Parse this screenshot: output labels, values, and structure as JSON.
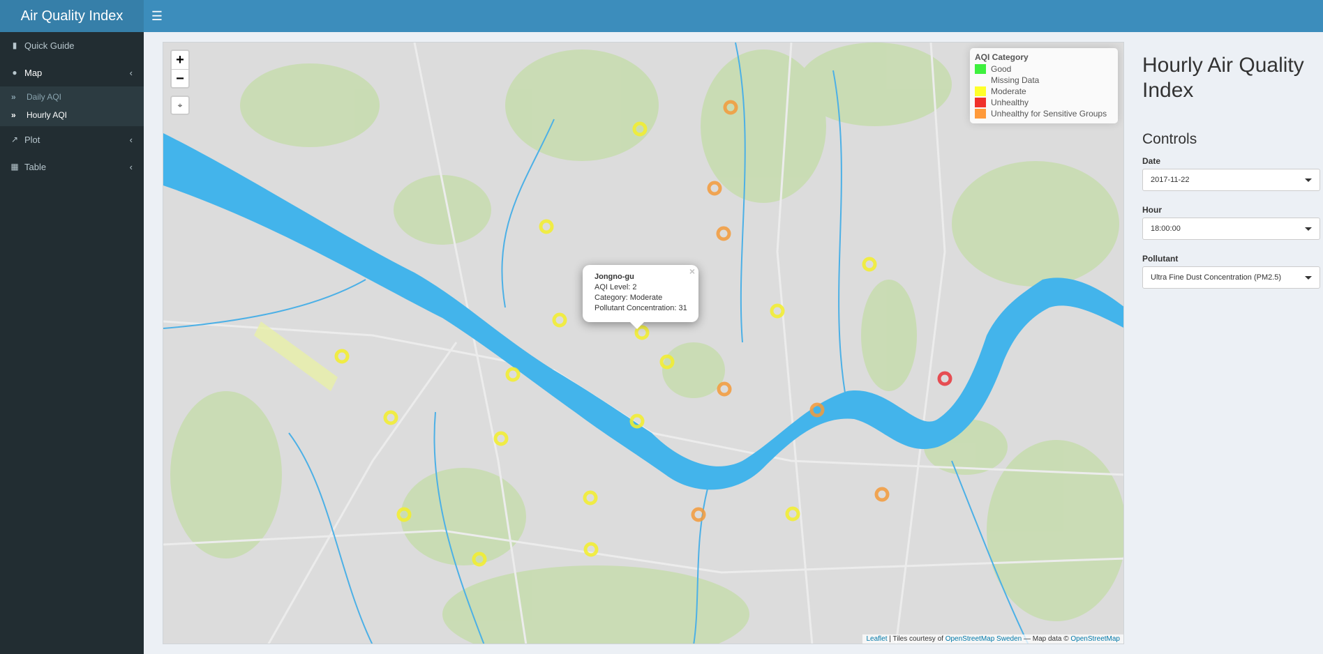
{
  "header": {
    "app_title": "Air Quality Index",
    "menu_icon": "hamburger-icon"
  },
  "sidebar": {
    "items": [
      {
        "label": "Quick Guide",
        "icon": "book-icon"
      },
      {
        "label": "Map",
        "icon": "map-pin-icon",
        "expanded": true,
        "children": [
          {
            "label": "Daily AQI",
            "icon": "double-chevron-right-icon"
          },
          {
            "label": "Hourly AQI",
            "icon": "double-chevron-right-icon",
            "active": true
          }
        ]
      },
      {
        "label": "Plot",
        "icon": "line-chart-icon"
      },
      {
        "label": "Table",
        "icon": "table-icon"
      }
    ]
  },
  "map": {
    "zoom_in_label": "+",
    "zoom_out_label": "−",
    "fullscreen_icon": "fullscreen-icon",
    "legend": {
      "title": "AQI Category",
      "items": [
        {
          "label": "Good",
          "color": "#3ef03e"
        },
        {
          "label": "Missing Data",
          "color": "transparent"
        },
        {
          "label": "Moderate",
          "color": "#ffff2a"
        },
        {
          "label": "Unhealthy",
          "color": "#f0302a"
        },
        {
          "label": "Unhealthy for Sensitive Groups",
          "color": "#ff9a3a"
        }
      ]
    },
    "popup": {
      "station": "Jongno-gu",
      "line1": "AQI Level: 2",
      "line2": "Category: Moderate",
      "line3": "Pollutant Concentration: 31",
      "close_label": "×"
    },
    "attribution": {
      "leaflet": "Leaflet",
      "sep1": " | Tiles courtesy of ",
      "osm_sweden": "OpenStreetMap Sweden",
      "sep2": " — Map data © ",
      "osm": "OpenStreetMap"
    },
    "category_colors": {
      "moderate": "#f3ee2a",
      "sensitive": "#f39a3a",
      "unhealthy": "#e8343a"
    }
  },
  "panel": {
    "title": "Hourly Air Quality Index",
    "controls_title": "Controls",
    "date_label": "Date",
    "date_value": "2017-11-22",
    "hour_label": "Hour",
    "hour_value": "18:00:00",
    "pollutant_label": "Pollutant",
    "pollutant_value": "Ultra Fine Dust Concentration (PM2.5)"
  }
}
